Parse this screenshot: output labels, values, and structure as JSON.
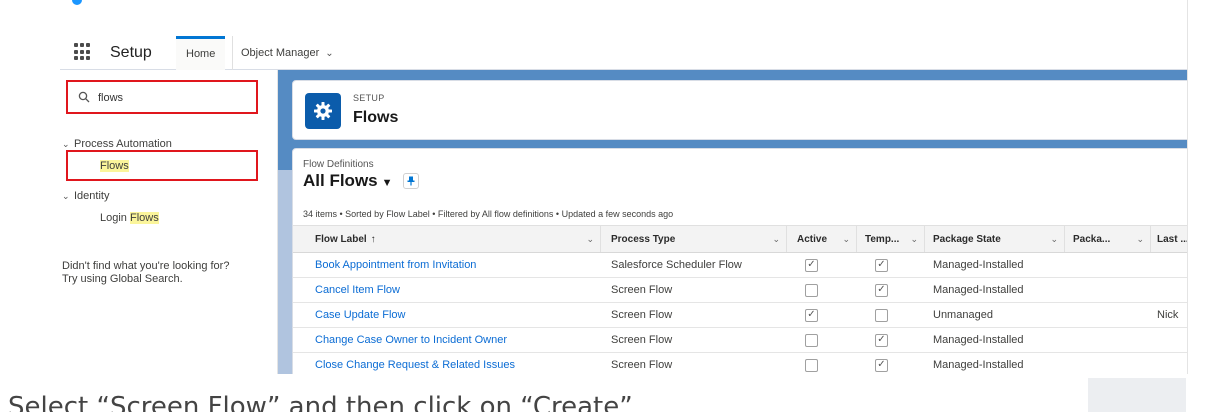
{
  "nav": {
    "app_name": "Setup",
    "tabs": [
      {
        "label": "Home"
      },
      {
        "label": "Object Manager"
      }
    ]
  },
  "sidebar": {
    "search": {
      "value": "flows"
    },
    "sections": [
      {
        "label": "Process Automation",
        "items": [
          "Flows"
        ]
      },
      {
        "label": "Identity",
        "items": [
          {
            "prefix": "Login ",
            "highlight": "Flows"
          }
        ]
      }
    ],
    "help_line1": "Didn't find what you're looking for?",
    "help_line2": "Try using Global Search."
  },
  "header": {
    "overline": "SETUP",
    "title": "Flows"
  },
  "list": {
    "sub": "Flow Definitions",
    "title": "All Flows",
    "meta": "34 items • Sorted by Flow Label • Filtered by All flow definitions • Updated a few seconds ago",
    "columns": [
      "Flow Label",
      "Process Type",
      "Active",
      "Temp...",
      "Package State",
      "Packa...",
      "Last ..."
    ],
    "rows": [
      {
        "label": "Book Appointment from Invitation",
        "type": "Salesforce Scheduler Flow",
        "active": true,
        "template": true,
        "state": "Managed-Installed",
        "package": "",
        "last": ""
      },
      {
        "label": "Cancel Item Flow",
        "type": "Screen Flow",
        "active": false,
        "template": true,
        "state": "Managed-Installed",
        "package": "",
        "last": ""
      },
      {
        "label": "Case Update Flow",
        "type": "Screen Flow",
        "active": true,
        "template": false,
        "state": "Unmanaged",
        "package": "",
        "last": "Nick"
      },
      {
        "label": "Change Case Owner to Incident Owner",
        "type": "Screen Flow",
        "active": false,
        "template": true,
        "state": "Managed-Installed",
        "package": "",
        "last": ""
      },
      {
        "label": "Close Change Request & Related Issues",
        "type": "Screen Flow",
        "active": false,
        "template": true,
        "state": "Managed-Installed",
        "package": "",
        "last": ""
      }
    ]
  },
  "caption": "Select “Screen Flow” and then click on “Create”",
  "colors": {
    "accent": "#0176d3",
    "highlight_box": "#e0161d",
    "match_highlight": "#fbf59b",
    "brand_banner": "#0b5cab"
  },
  "icons": [
    "app-launcher-icon",
    "search-icon",
    "chevron-down-icon",
    "gear-icon",
    "pin-icon",
    "checkbox-icon"
  ]
}
